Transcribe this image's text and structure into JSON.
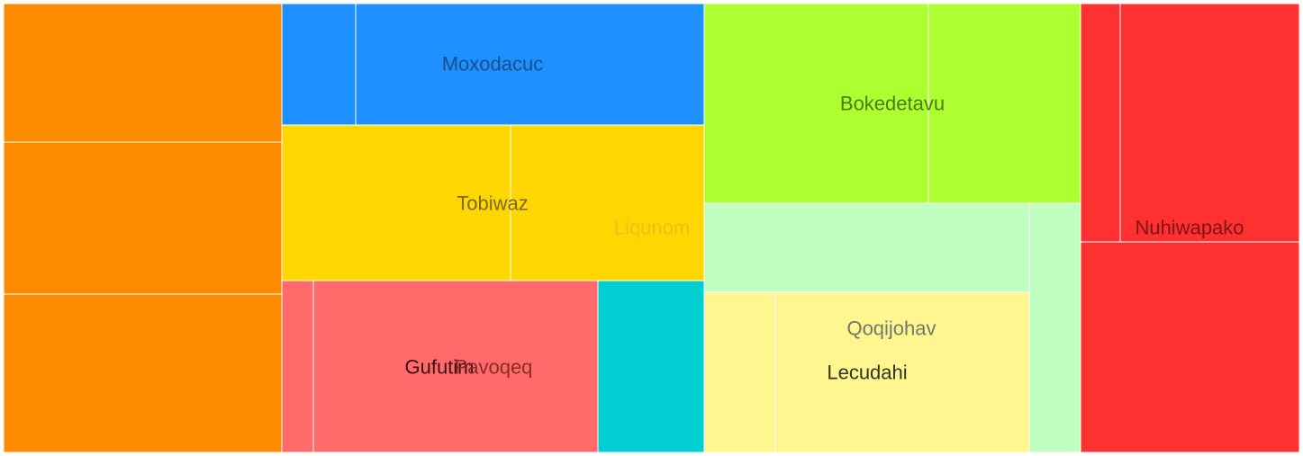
{
  "chart_data": {
    "type": "treemap",
    "labels": [
      {
        "text": "Moxodacuc",
        "color": "#1a4f8c"
      },
      {
        "text": "Tobiwaz",
        "color": "#7a6a1e"
      },
      {
        "text": "Liqunom",
        "color": "#e6c21a"
      },
      {
        "text": "Gufutim",
        "color": "#3a1010"
      },
      {
        "text": "Pavoqeq",
        "color": "#8a2a2a"
      },
      {
        "text": "Bokedetavu",
        "color": "#4f7a18"
      },
      {
        "text": "Qoqijohav",
        "color": "#6f7a6f"
      },
      {
        "text": "Lecudahi",
        "color": "#333322"
      },
      {
        "text": "Nuhiwapako",
        "color": "#7a1616"
      }
    ],
    "nodes": [
      {
        "group": "orange",
        "value": 4.8,
        "color": "#ff8c00"
      },
      {
        "group": "orange",
        "value": 5.2,
        "color": "#ff8c00"
      },
      {
        "group": "orange",
        "value": 5.4,
        "color": "#ff8c00"
      },
      {
        "group": "blue",
        "value": 1.1,
        "color": "#1e90ff"
      },
      {
        "group": "blue",
        "value": 5.2,
        "color": "#1e90ff"
      },
      {
        "group": "gold",
        "value": 4.4,
        "color": "#ffd700"
      },
      {
        "group": "gold",
        "value": 3.7,
        "color": "#ffd700"
      },
      {
        "group": "salmon",
        "value": 0.7,
        "color": "#ff6a6a"
      },
      {
        "group": "salmon",
        "value": 6.0,
        "color": "#ff6a6a"
      },
      {
        "group": "cyan",
        "value": 2.2,
        "color": "#00ced1"
      },
      {
        "group": "lime",
        "value": 5.6,
        "color": "#adff2f"
      },
      {
        "group": "lime",
        "value": 3.8,
        "color": "#adff2f"
      },
      {
        "group": "mint",
        "value": 3.5,
        "color": "#c1ffc1"
      },
      {
        "group": "mint",
        "value": 1.5,
        "color": "#c1ffc1"
      },
      {
        "group": "yellow",
        "value": 1.5,
        "color": "#fff68f"
      },
      {
        "group": "yellow",
        "value": 5.4,
        "color": "#fff68f"
      },
      {
        "group": "red",
        "value": 1.2,
        "color": "#ff3030"
      },
      {
        "group": "red",
        "value": 5.3,
        "color": "#ff3030"
      },
      {
        "group": "red",
        "value": 5.8,
        "color": "#ff3030"
      }
    ]
  }
}
